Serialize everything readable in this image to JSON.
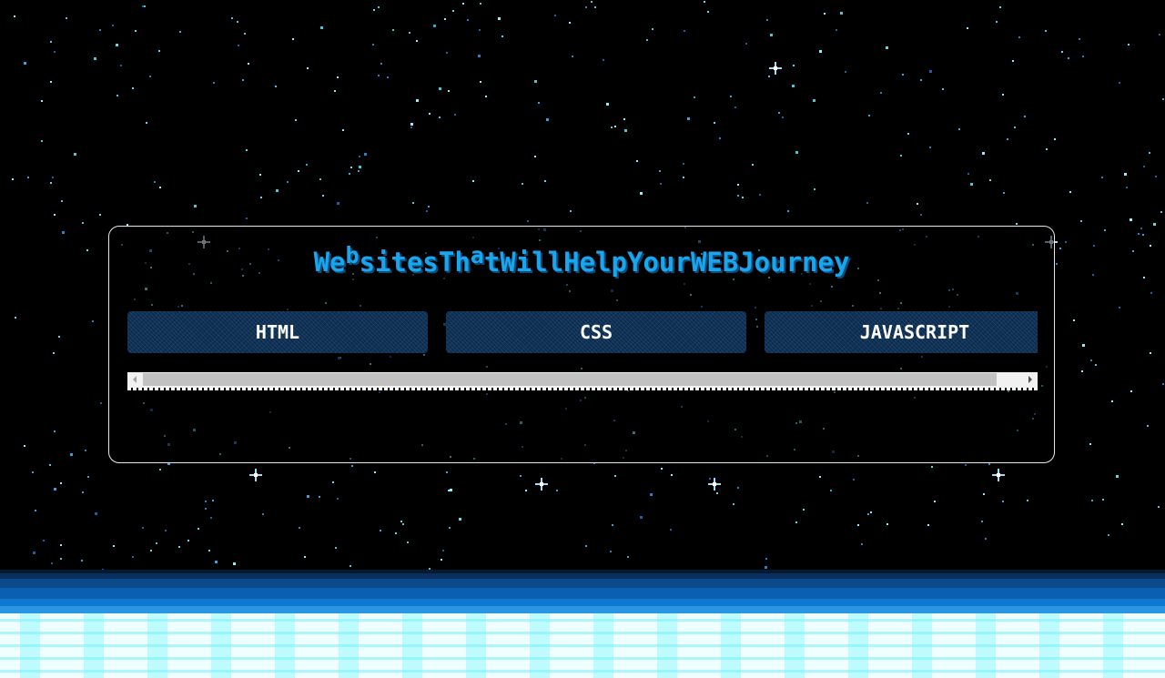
{
  "header": {
    "title_parts": [
      {
        "text": "We",
        "raised": false
      },
      {
        "text": "b",
        "raised": true
      },
      {
        "text": "sitesTh",
        "raised": false
      },
      {
        "text": "a",
        "raised": true
      },
      {
        "text": "tWillHelpYourWEBJourney",
        "raised": false
      }
    ]
  },
  "tabs": [
    {
      "label": "HTML"
    },
    {
      "label": "CSS"
    },
    {
      "label": "JAVASCRIPT"
    }
  ],
  "scrollbar": {
    "position": 0.0,
    "left_arrow_icon": "chevron-left-icon",
    "right_arrow_icon": "chevron-right-icon"
  },
  "colors": {
    "title": "#1aa6ee",
    "tab_text": "#ffffff",
    "panel_border": "#e8e8e8",
    "background": "#000000"
  }
}
